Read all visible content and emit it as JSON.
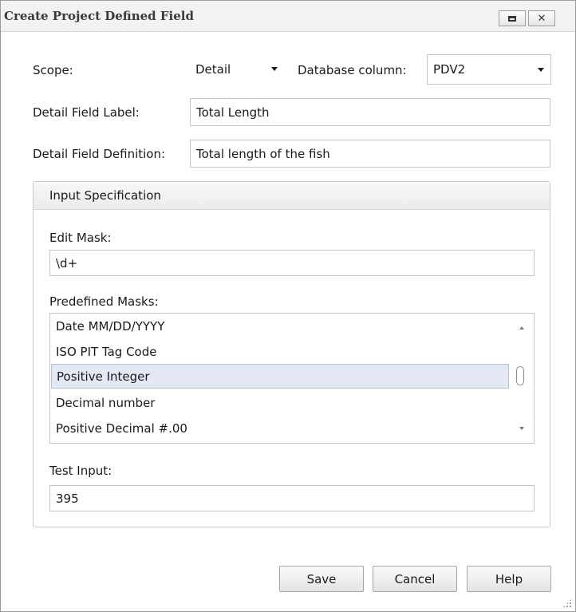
{
  "window": {
    "title": "Create Project Defined Field",
    "maximize_glyph": "maximize-icon",
    "close_glyph": "✕"
  },
  "scope": {
    "label": "Scope:",
    "value": "Detail"
  },
  "database_column": {
    "label": "Database column:",
    "value": "PDV2"
  },
  "detail_field_label": {
    "label": "Detail Field Label:",
    "value": "Total Length"
  },
  "detail_field_definition": {
    "label": "Detail Field Definition:",
    "value": "Total length of the fish"
  },
  "input_specification": {
    "header": "Input Specification",
    "edit_mask": {
      "label": "Edit Mask:",
      "value": "\\d+"
    },
    "predefined_masks": {
      "label": "Predefined Masks:",
      "items": [
        "Date MM/DD/YYYY",
        "ISO PIT Tag Code",
        "Positive Integer",
        "Decimal number",
        "Positive Decimal #.00"
      ],
      "selected": "Positive Integer"
    },
    "test_input": {
      "label": "Test Input:",
      "value": "395"
    }
  },
  "buttons": {
    "save": "Save",
    "cancel": "Cancel",
    "help": "Help"
  },
  "colors": {
    "selection_bg": "#e3e8f4",
    "selection_border": "#b7c1da"
  }
}
